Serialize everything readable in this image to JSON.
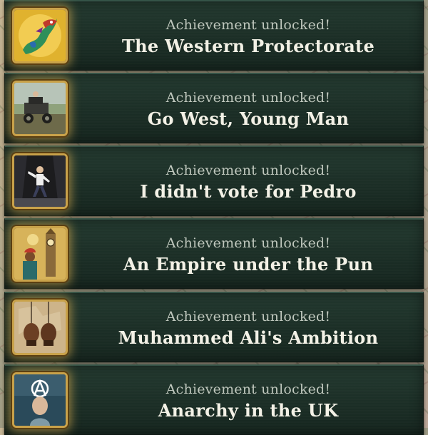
{
  "achievements": [
    {
      "subtitle": "Achievement unlocked!",
      "title": "The Western Protectorate",
      "icon": "dragon-icon"
    },
    {
      "subtitle": "Achievement unlocked!",
      "title": "Go West, Young Man",
      "icon": "vintage-car-icon"
    },
    {
      "subtitle": "Achievement unlocked!",
      "title": "I didn't vote for Pedro",
      "icon": "dancer-icon"
    },
    {
      "subtitle": "Achievement unlocked!",
      "title": "An Empire under the Pun",
      "icon": "big-ben-icon"
    },
    {
      "subtitle": "Achievement unlocked!",
      "title": "Muhammed Ali's Ambition",
      "icon": "boxing-gloves-icon"
    },
    {
      "subtitle": "Achievement unlocked!",
      "title": "Anarchy in the UK",
      "icon": "queen-anarchy-icon"
    }
  ]
}
